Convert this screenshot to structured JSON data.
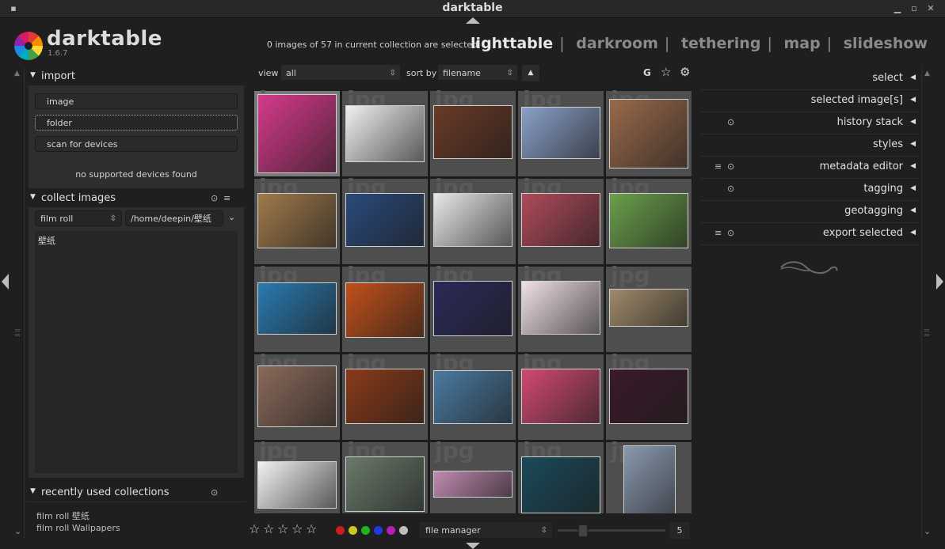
{
  "window": {
    "title": "darktable"
  },
  "app": {
    "name": "darktable",
    "version": "1.6.7"
  },
  "header": {
    "selection_info": "0 images of 57 in current collection are selected",
    "views": [
      "lighttable",
      "darkroom",
      "tethering",
      "map",
      "slideshow"
    ],
    "active_view": "lighttable",
    "separator": "|"
  },
  "left_panel": {
    "import": {
      "title": "import",
      "buttons": [
        "image",
        "folder",
        "scan for devices"
      ],
      "status": "no supported devices found"
    },
    "collect": {
      "title": "collect images",
      "property": "film roll",
      "path": "/home/deepin/壁纸",
      "items": [
        "壁纸"
      ]
    },
    "recent": {
      "title": "recently used collections",
      "items": [
        "film roll 壁纸",
        "film roll Wallpapers"
      ]
    }
  },
  "toolbar": {
    "view_label": "view",
    "view_value": "all",
    "sort_label": "sort by",
    "sort_value": "filename",
    "sort_direction_icon": "triangle-up-icon",
    "group_label": "G"
  },
  "grid": {
    "columns": 5,
    "placeholder": "jpg",
    "thumb_colors": [
      [
        "#d63a8a",
        "#f0f0f0",
        "#6a3a26",
        "#8aa0c8",
        "#9a6a4a"
      ],
      [
        "#a07a4a",
        "#2a4a7a",
        "#e8e8e8",
        "#b04a5a",
        "#6aa04a"
      ],
      [
        "#2a7ab0",
        "#c0501a",
        "#2a2a5a",
        "#f0e0e8",
        "#a08a6a"
      ],
      [
        "#8a6a5a",
        "#8a3a1a",
        "#4a7aa0",
        "#d04a70",
        "#3a1a2a"
      ],
      [
        "#f2f2f2",
        "#6a7a6a",
        "#c08ab0",
        "#1a4a5a",
        "#8a9ab0"
      ]
    ]
  },
  "bottom_bar": {
    "stars": 5,
    "color_labels": [
      "#c81e1e",
      "#c8c81e",
      "#1eb41e",
      "#1e3ce6",
      "#b41eb4",
      "#bebebe"
    ],
    "layout": "file manager",
    "zoom": "5"
  },
  "right_panel": {
    "modules": [
      {
        "label": "select",
        "icons": []
      },
      {
        "label": "selected image[s]",
        "icons": []
      },
      {
        "label": "history stack",
        "icons": [
          "reset-icon"
        ]
      },
      {
        "label": "styles",
        "icons": []
      },
      {
        "label": "metadata editor",
        "icons": [
          "presets-icon",
          "reset-icon"
        ]
      },
      {
        "label": "tagging",
        "icons": [
          "reset-icon"
        ]
      },
      {
        "label": "geotagging",
        "icons": []
      },
      {
        "label": "export selected",
        "icons": [
          "presets-icon",
          "reset-icon"
        ]
      }
    ]
  }
}
